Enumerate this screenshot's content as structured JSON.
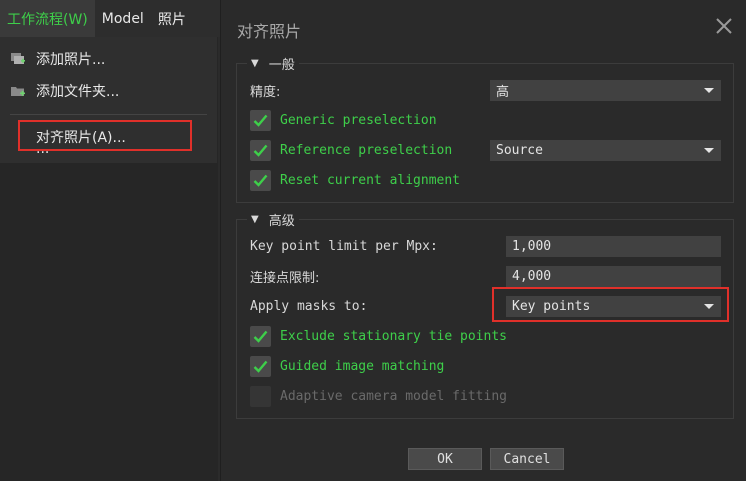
{
  "menubar": {
    "items": [
      {
        "label": "工作流程(W)"
      },
      {
        "label": "Model"
      },
      {
        "label": "照片"
      }
    ]
  },
  "workflow_menu": {
    "items": [
      {
        "label": "添加照片...",
        "icon": "add-photo-icon"
      },
      {
        "label": "添加文件夹...",
        "icon": "add-folder-icon"
      },
      {
        "label": "对齐照片(A)..."
      },
      {
        "label": "..."
      }
    ]
  },
  "dialog": {
    "title": "对齐照片",
    "general": {
      "title": "一般",
      "accuracy_label": "精度:",
      "accuracy_value": "高",
      "generic_preselection": {
        "label": "Generic preselection",
        "checked": true
      },
      "reference_preselection": {
        "label": "Reference preselection",
        "checked": true,
        "mode": "Source"
      },
      "reset_alignment": {
        "label": "Reset current alignment",
        "checked": true
      }
    },
    "advanced": {
      "title": "高级",
      "key_point_label": "Key point limit per Mpx:",
      "key_point_value": "1,000",
      "tie_point_label": "连接点限制:",
      "tie_point_value": "4,000",
      "masks_label": "Apply masks to:",
      "masks_value": "Key points",
      "exclude_stationary": {
        "label": "Exclude stationary tie points",
        "checked": true
      },
      "guided_matching": {
        "label": "Guided image matching",
        "checked": true
      },
      "adaptive_fitting": {
        "label": "Adaptive camera model fitting",
        "checked": false
      }
    },
    "ok_label": "OK",
    "cancel_label": "Cancel"
  },
  "colors": {
    "accent_green": "#3ecf4a",
    "highlight_red": "#e0302a"
  }
}
